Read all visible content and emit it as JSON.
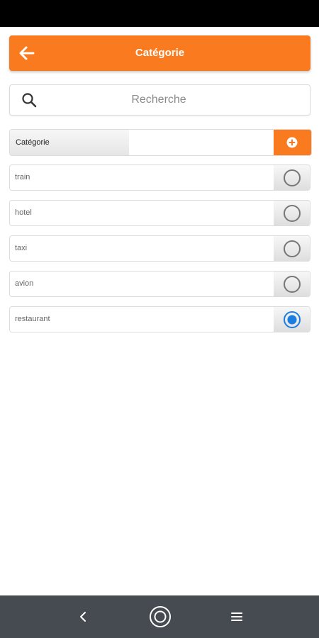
{
  "header": {
    "title": "Catégorie",
    "back_icon": "arrow-left-icon",
    "background": "#fa7a1f"
  },
  "search": {
    "placeholder": "Recherche",
    "value": "",
    "icon": "search-icon"
  },
  "category_form": {
    "label": "Catégorie",
    "value": "",
    "add_icon": "plus-circle-icon"
  },
  "items": [
    {
      "label": "train",
      "selected": false
    },
    {
      "label": "hotel",
      "selected": false
    },
    {
      "label": "taxi",
      "selected": false
    },
    {
      "label": "avion",
      "selected": false
    },
    {
      "label": "restaurant",
      "selected": true
    }
  ],
  "colors": {
    "accent": "#fa7a1f",
    "radio_selected": "#1a7ee0",
    "radio_unselected": "#777777",
    "navbar": "#454b50"
  },
  "navbar": {
    "back_icon": "chevron-left-icon",
    "home_icon": "home-circle-icon",
    "menu_icon": "menu-icon"
  }
}
